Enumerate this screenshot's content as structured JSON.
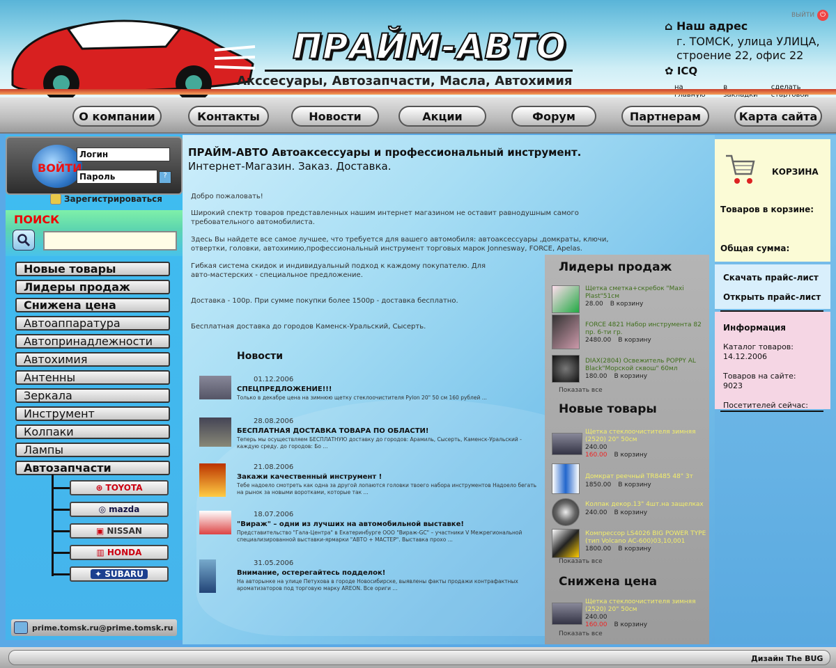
{
  "header": {
    "brand": "ПРАЙМ-АВТО",
    "tagline": "Акссесуары, Автозапчасти, Масла, Автохимия",
    "exit": "ВЫЙТИ",
    "address_title": "Наш адрес",
    "address_line1": "г. ТОМСК, улица УЛИЦА,",
    "address_line2": "строение 22, офис 22",
    "icq": "ICQ",
    "links": [
      "на главную",
      "в закладки",
      "сделать стартовой"
    ]
  },
  "nav": [
    "О компании",
    "Контакты",
    "Новости",
    "Акции",
    "Форум",
    "Партнерам",
    "Карта сайта"
  ],
  "login": {
    "word": "ВОЙТИ",
    "login_value": "Логин",
    "password_value": "Пароль",
    "register": "Зарегистрироваться"
  },
  "search": {
    "title": "ПОИСК",
    "value": ""
  },
  "categories": [
    {
      "label": "Новые товары",
      "bold": true
    },
    {
      "label": "Лидеры продаж",
      "bold": true
    },
    {
      "label": "Снижена цена",
      "bold": true
    },
    {
      "label": "Автоаппаратура",
      "bold": false
    },
    {
      "label": "Автопринадлежности",
      "bold": false
    },
    {
      "label": "Автохимия",
      "bold": false
    },
    {
      "label": "Антенны",
      "bold": false
    },
    {
      "label": "Зеркала",
      "bold": false
    },
    {
      "label": "Инструмент",
      "bold": false
    },
    {
      "label": "Колпаки",
      "bold": false
    },
    {
      "label": "Лампы",
      "bold": false
    },
    {
      "label": "Автозапчасти",
      "bold": true
    }
  ],
  "brands": [
    "TOYOTA",
    "mazda",
    "NISSAN",
    "HONDA",
    "SUBARU"
  ],
  "email": "prime.tomsk.ru@prime.tomsk.ru",
  "main": {
    "title": "ПРАЙМ-АВТО Автоаксессуары и профессиональный инструмент.",
    "subtitle": "Интернет-Магазин. Заказ. Доставка.",
    "intro": [
      "Добро пожаловать!",
      "Широкий спектр товаров представленных нашим интернет магазином не оставит равнодушным самого требовательного автомобилиста.",
      "Здесь Вы найдете все самое лучшее, что требуется для вашего автомобиля: автоаксессуары ,домкраты, ключи, отвертки, головки, автохимию,профессиональный инструмент торговых марок Jonnesway, FORCE, Apelas.",
      "Гибкая система скидок и индивидуальный подход к каждому покупателю. Для авто-мастерских - специальное предложение.",
      "Доставка - 100р. При сумме покупки более 1500р - доставка бесплатно.",
      "Бесплатная доставка до городов Каменск-Уральский, Сысерть."
    ],
    "news_heading": "Новости",
    "news": [
      {
        "date": "01.12.2006",
        "title": "СПЕЦПРЕДЛОЖЕНИЕ!!!",
        "text": "Только в декабре цена на зимнюю щетку стеклоочистителя Pylon 20\" 50 см 160 рублей ..."
      },
      {
        "date": "28.08.2006",
        "title": "БЕСПЛАТНАЯ ДОСТАВКА ТОВАРА ПО ОБЛАСТИ!",
        "text": "Теперь мы осуществляем БЕСПЛАТНУЮ доставку до городов: Арамиль, Сысерть, Каменск-Уральский - каждую среду. до городов: Бо ..."
      },
      {
        "date": "21.08.2006",
        "title": "Закажи качественный инструмент !",
        "text": "Тебе надоело смотреть как одна за другой лопаются головки твоего набора инструментов Надоело бегать на рынок за новыми воротками, которые так ..."
      },
      {
        "date": "18.07.2006",
        "title": "\"Вираж\" – одни из лучших на автомобильной выставке!",
        "text": "Представительство \"Гала-Центра\" в Екатеринбурге ООО \"Вираж-GC\" – участники V Межрегиональной специализированной выставки-ярмарки \"АВТО + МАСТЕР\". Выставка прохо ..."
      },
      {
        "date": "31.05.2006",
        "title": "Внимание, остерегайтесь подделок!",
        "text": "На авторынке на улице Петухова в городе Новосибирске, выявлены факты продажи контрафактных ароматизаторов под торговую марку AREON. Все ориги ..."
      }
    ]
  },
  "panels": {
    "cart_label": "В корзину",
    "show_all": "Показать все",
    "leaders": {
      "title": "Лидеры продаж",
      "items": [
        {
          "name": "Щетка сметка+скребок \"Maxi Plast\"51см",
          "price": "28.00"
        },
        {
          "name": "FORCE 4821 Набор инструмента 82 пр. 6-ти гр.",
          "price": "2480.00"
        },
        {
          "name": "DIAX(2804) Освежитель POPPY AL Black\"Морской сквош\" 60мл",
          "price": "180.00"
        }
      ]
    },
    "new_items": {
      "title": "Новые товары",
      "items": [
        {
          "name": "Щетка стеклоочистителя зимняя (2520) 20\" 50см",
          "price": "240.00",
          "old_price": "160.00"
        },
        {
          "name": "Домкрат реечный TR8485 48\" 3т",
          "price": "1850.00"
        },
        {
          "name": "Колпак декор.13\" 4шт.на защелках",
          "price": "240.00"
        },
        {
          "name": "Компрессор LS4026 BIG POWER TYPE (тип Volcano AC-600)03,10,001",
          "price": "1800.00"
        }
      ]
    },
    "discount": {
      "title": "Снижена цена",
      "items": [
        {
          "name": "Щетка стеклоочистителя зимняя (2520) 20\" 50см",
          "price": "240.00",
          "old_price": "160.00"
        }
      ]
    }
  },
  "right": {
    "cart_title": "КОРЗИНА",
    "cart_count": "Товаров в корзине:",
    "cart_sum": "Общая сумма:",
    "download_price": "Скачать прайс-лист",
    "open_price": "Открыть прайс-лист",
    "info_title": "Информация",
    "catalog_label": "Каталог товаров:",
    "catalog_date": "14.12.2006",
    "items_label": "Товаров на сайте:",
    "items_count": "9023",
    "visitors_label": "Посетителей сейчас:"
  },
  "footer": {
    "credit": "Дизайн The BUG"
  },
  "colors": {
    "accent_red": "#e11111",
    "panel_gray": "#a8a8a8",
    "cart_bg": "#fbfbd6",
    "info_bg": "#f5d6e4"
  }
}
